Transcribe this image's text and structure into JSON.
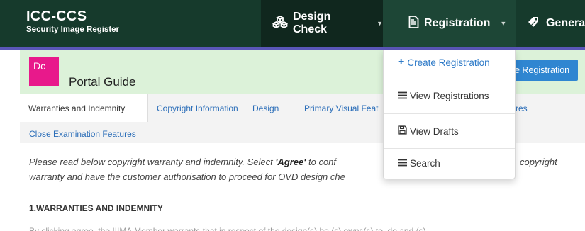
{
  "brand": {
    "title": "ICC-CCS",
    "subtitle": "Security Image Register"
  },
  "nav": {
    "design_check": "Design Check",
    "registration": "Registration",
    "general": "Genera"
  },
  "header": {
    "badge": "Dc",
    "title": "Portal Guide",
    "button": "e Registration"
  },
  "tabs": {
    "warranties": "Warranties and Indemnity",
    "copyright": "Copyright Information",
    "design": "Design",
    "primary_visual": "Primary Visual Feat",
    "partial_res": "res",
    "close_exam": "Close Examination Features"
  },
  "content": {
    "intro_part1": "Please read below copyright warranty and indemnity. Select ",
    "intro_agree": "'Agree'",
    "intro_part2": " to conf",
    "intro_right": "copyright",
    "intro_line2": "warranty and have the customer authorisation to proceed for OVD design che",
    "heading": "1.WARRANTIES AND INDEMNITY",
    "cut_text": "By clicking agree, the IIIMA Member warrants that in respect of the design(s) he (s) owns(s) to, do and (s)"
  },
  "dropdown": {
    "create": "Create Registration",
    "view": "View Registrations",
    "drafts": "View Drafts",
    "search": "Search"
  },
  "colors": {
    "navbar": "#163a2c",
    "accent": "#5a56b8",
    "header_band": "#dcf2d9",
    "badge": "#e8198b",
    "link": "#2a6db8"
  }
}
